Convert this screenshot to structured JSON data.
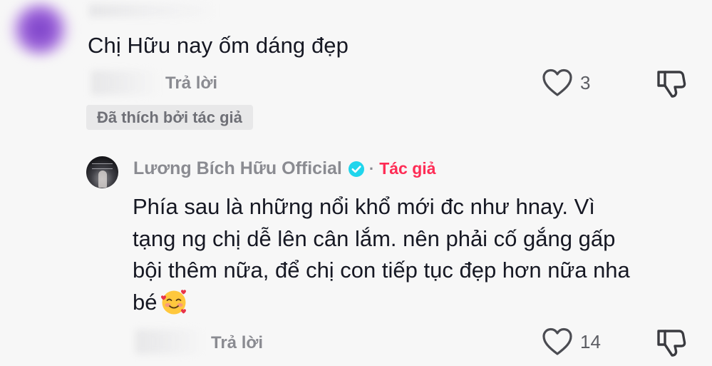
{
  "comment": {
    "text": "Chị Hữu nay ốm dáng đẹp",
    "reply_label": "Trả lời",
    "like_count": "3",
    "liked_by_author_label": "Đã thích bởi tác giả"
  },
  "reply": {
    "author_name": "Lương Bích Hữu Official",
    "separator": "·",
    "author_tag": "Tác giả",
    "text": "Phía sau là những nổi khổ mới đc như hnay. Vì tạng ng chị dễ lên cân lắm. nên phải cố gắng gấp bội thêm nữa, để chị con tiếp tục đẹp hơn nữa nha bé",
    "reply_label": "Trả lời",
    "like_count": "14"
  },
  "colors": {
    "accent": "#fe2c55",
    "verified": "#20d5ec",
    "muted_text": "#8a8b91"
  },
  "icons": {
    "like": "heart-outline-icon",
    "dislike": "thumbs-down-icon",
    "verified": "verified-badge-icon",
    "emoji": "smiling-face-with-hearts-emoji"
  }
}
